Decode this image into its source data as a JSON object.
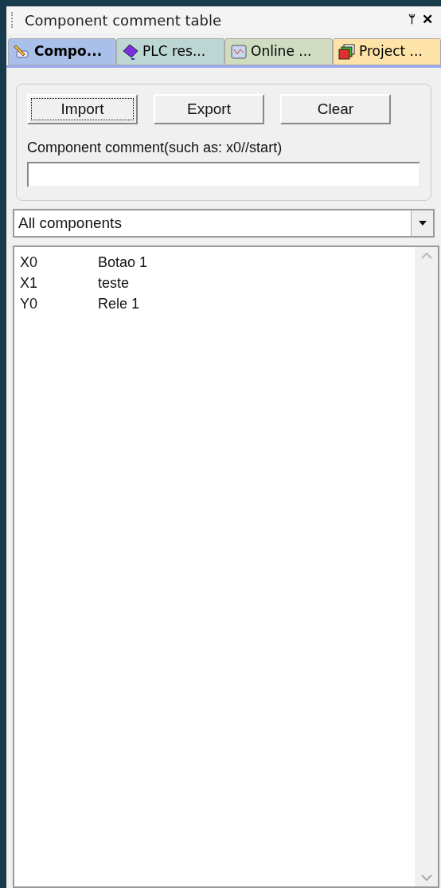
{
  "panel": {
    "title": "Component comment table",
    "pin": "ᛘ",
    "close": "✕"
  },
  "tabs": [
    {
      "label": "Compo...",
      "selected": true,
      "color": "#a9c1ea",
      "kind": "pencil"
    },
    {
      "label": "PLC res...",
      "selected": false,
      "color": "#bcd7d3",
      "kind": "chip"
    },
    {
      "label": "Online ...",
      "selected": false,
      "color": "#cfdcc0",
      "kind": "monitor"
    },
    {
      "label": "Project ...",
      "selected": false,
      "color": "#fde3a7",
      "kind": "stack"
    }
  ],
  "buttons": [
    {
      "label": "Import",
      "focused": true
    },
    {
      "label": "Export",
      "focused": false
    },
    {
      "label": "Clear",
      "focused": false
    }
  ],
  "comment_field": {
    "label": "Component comment(such as: x0//start)"
  },
  "filter": {
    "value": "All components"
  },
  "list": [
    {
      "address": "X0",
      "comment": "Botao 1"
    },
    {
      "address": "X1",
      "comment": "teste"
    },
    {
      "address": "Y0",
      "comment": "Rele 1"
    }
  ]
}
